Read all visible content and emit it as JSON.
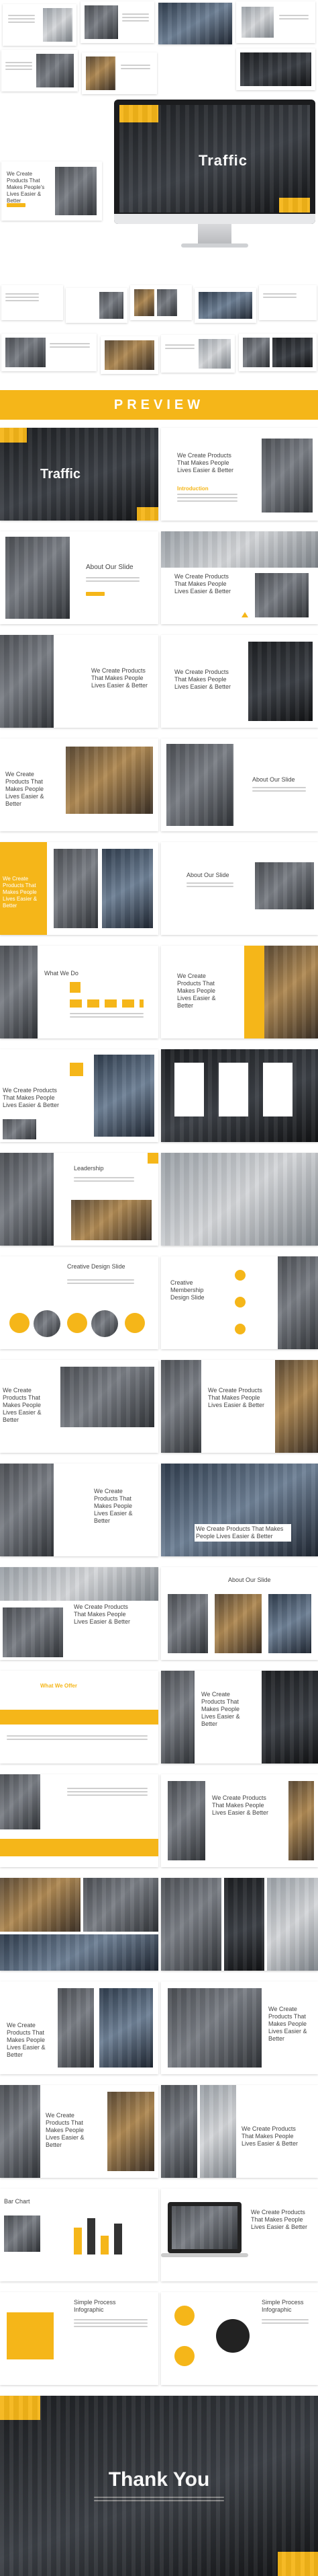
{
  "preview_banner": {
    "label": "PREVIEW"
  },
  "hero": {
    "title": "Traffic",
    "tagline": "We Create Products That Makes People's Lives Easier & Better"
  },
  "slides": {
    "s2_title": "Traffic",
    "s3_text": "We Create Products That Makes People Lives Easier & Better",
    "s3_sub": "Introduction",
    "s4_title": "About Our Slide",
    "s5_text": "We Create Products That Makes People Lives Easier & Better",
    "s6_text": "We Create Products That Makes People Lives Easier & Better",
    "s7_text": "We Create Products That Makes People Lives Easier & Better",
    "s8_title": "About Our Slide",
    "s9_text": "We Create Products That Makes People Lives Easier & Better",
    "s10_title": "About Our Slide",
    "s11_title": "What We Do",
    "s12_text": "We Create Products That Makes People Lives Easier & Better",
    "s13_text": "We Create Products That Makes People Lives Easier & Better",
    "s14_text": "We Create Products That Makes People Lives Easier & Better",
    "s15_title": "Leadership",
    "s16_title": "Creative Design Slide",
    "s17_title": "Creative Membership Design Slide",
    "s18_text": "We Create Products That Makes People Lives Easier & Better",
    "s19_text": "We Create Products That Makes People Lives Easier & Better",
    "s20_text": "We Create Products That Makes People Lives Easier & Better",
    "s21_text": "We Create Products That Makes People Lives Easier & Better",
    "s22_text": "We Create Products That Makes People Lives Easier & Better",
    "s23_title": "About Our Slide",
    "s24_text": "We Create Products That Makes People Lives Easier & Better",
    "s25_title": "What We Offer",
    "s26_text": "We Create Products That Makes People Lives Easier & Better",
    "s27_text": "We Create Products That Makes People Lives Easier & Better",
    "s28_text": "We Create Products That Makes People Lives Easier & Better",
    "s29_text": "We Create Products That Makes People Lives Easier & Better",
    "s30_text": "We Create Products That Makes People Lives Easier & Better",
    "s31_title": "Bar Chart",
    "s32_text": "We Create Products That Makes People Lives Easier & Better",
    "s33_title": "Simple Process Infographic",
    "s34_title": "Simple Process Infographic"
  },
  "thank_you": {
    "title": "Thank You"
  },
  "colors": {
    "accent": "#f5b619",
    "dark": "#1d1f22"
  }
}
